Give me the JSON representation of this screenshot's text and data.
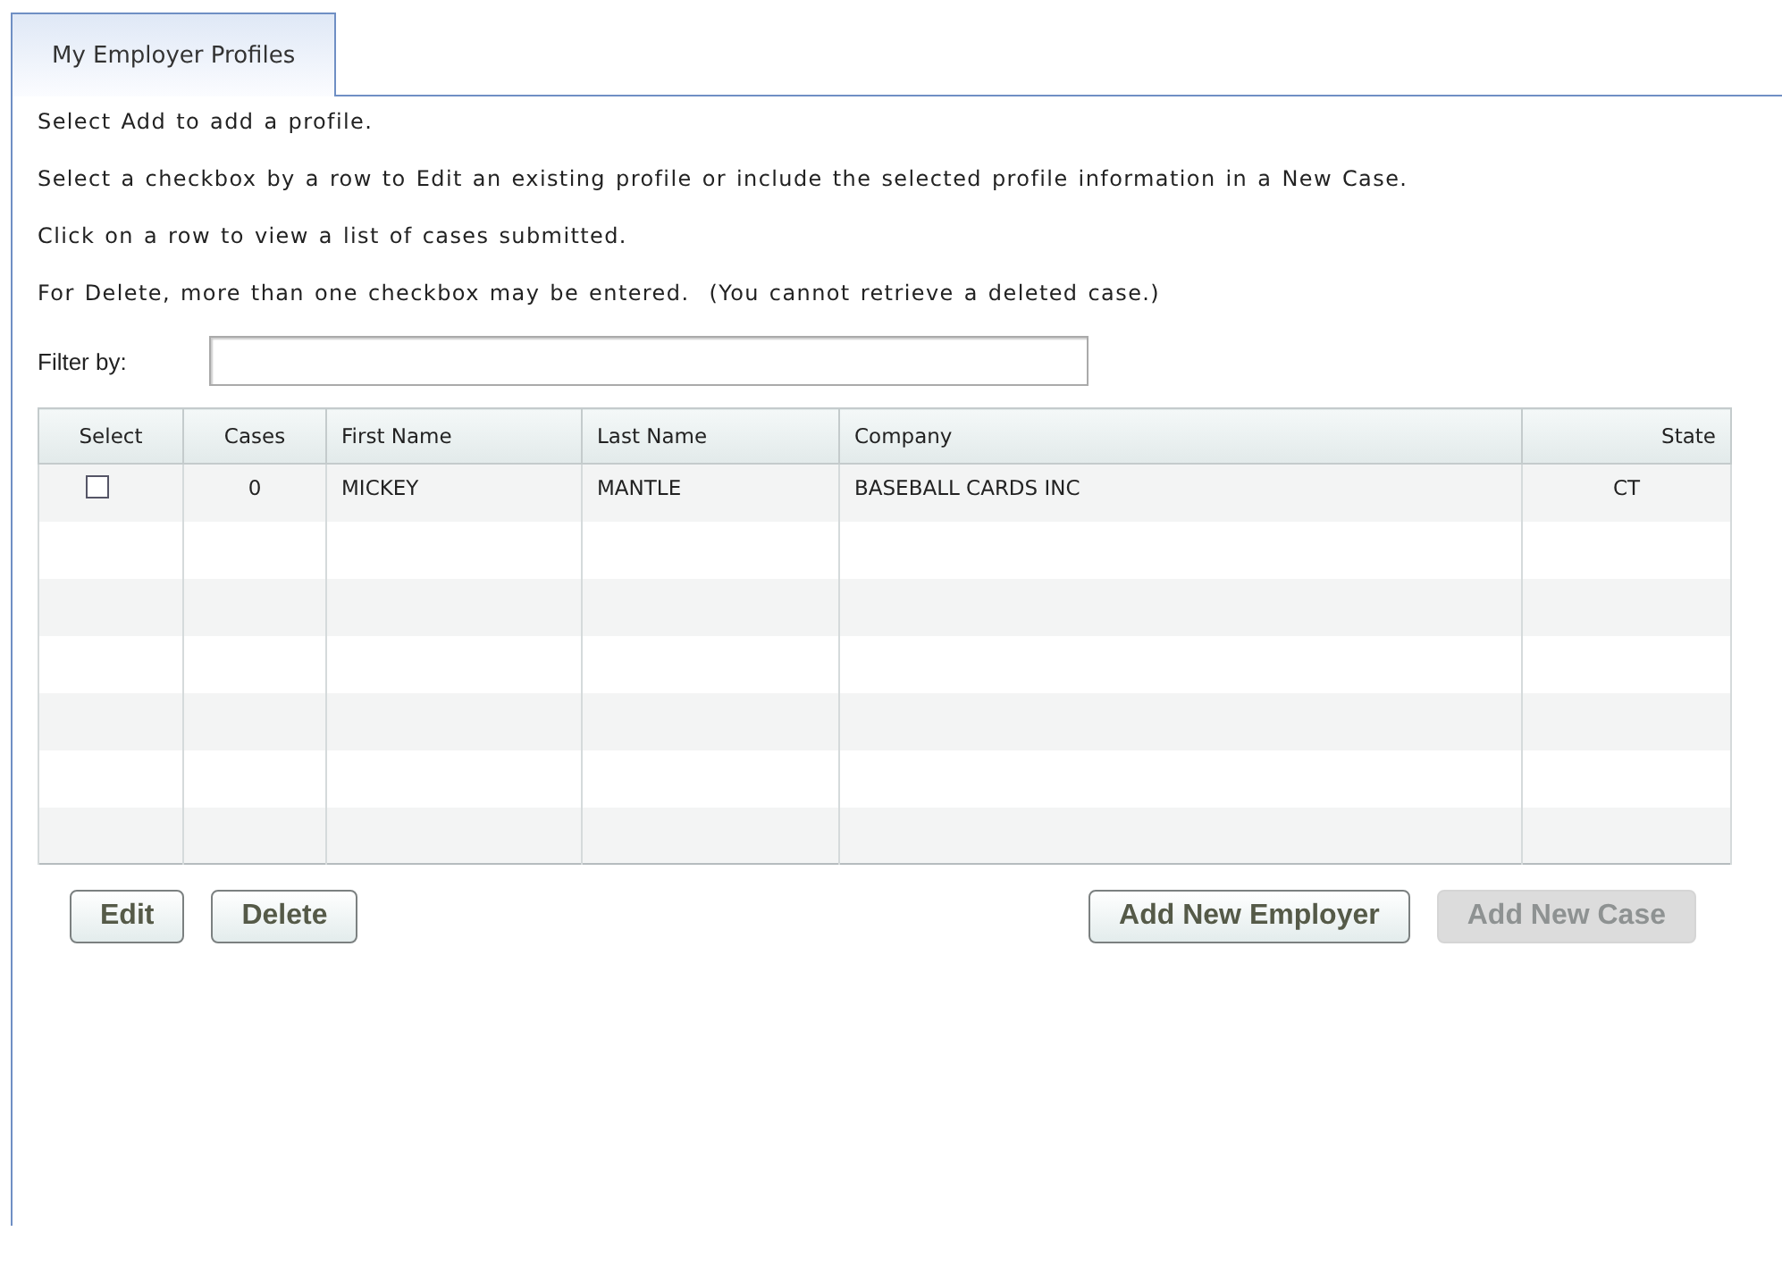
{
  "tabs": [
    {
      "label": "My Employer Profiles",
      "selected": true
    }
  ],
  "instructions": [
    "Select Add to add a profile.",
    "Select a checkbox by a row to Edit an existing profile or include the selected profile information in a New Case.",
    "Click on a row to view a list of cases submitted.",
    "For Delete, more than one checkbox may be entered.  (You cannot retrieve a deleted case.)"
  ],
  "filter": {
    "label": "Filter by:"
  },
  "table": {
    "columns": [
      "Select",
      "Cases",
      "First Name",
      "Last Name",
      "Company",
      "State"
    ],
    "rows": [
      {
        "checked": false,
        "cases": "0",
        "first_name": "MICKEY",
        "last_name": "MANTLE",
        "company": "BASEBALL CARDS INC",
        "state": "CT"
      }
    ]
  },
  "left_buttons": [
    {
      "label": "Edit",
      "disabled": false
    },
    {
      "label": "Delete",
      "disabled": false
    }
  ],
  "right_buttons": [
    {
      "label": "Add New Employer",
      "disabled": false
    },
    {
      "label": "Add New Case",
      "disabled": true
    }
  ]
}
